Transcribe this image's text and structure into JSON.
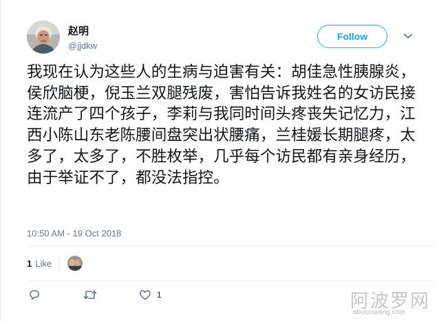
{
  "author": {
    "display_name": "赵明",
    "screen_name": "@jjdkw"
  },
  "follow_button": {
    "label": "Follow"
  },
  "tweet": {
    "text": "我现在认为这些人的生病与迫害有关：胡佳急性胰腺炎，侯欣脑梗，倪玉兰双腿残废，害怕告诉我姓名的女访民接连流产了四个孩子，李莉与我同时间头疼丧失记忆力，江西小陈山东老陈腰间盘突出状腰痛，兰桂媛长期腿疼，太多了，太多了，不胜枚举，几乎每个访民都有亲身经历，由于举证不了，都没法指控。",
    "timestamp": "10:50 AM - 19 Oct 2018"
  },
  "stats": {
    "like_count": "1",
    "like_label": "Like"
  },
  "actions": {
    "reply_count": "",
    "retweet_count": "",
    "like_count": "1"
  },
  "watermark": {
    "brand": "阿波罗网",
    "url": "aboluowang.com"
  },
  "colors": {
    "accent": "#1da1f2",
    "secondary_text": "#657786",
    "divider": "#e6ecf0"
  },
  "icons": {
    "reply": "reply-icon",
    "retweet": "retweet-icon",
    "like": "heart-icon",
    "menu": "chevron-down-icon"
  }
}
